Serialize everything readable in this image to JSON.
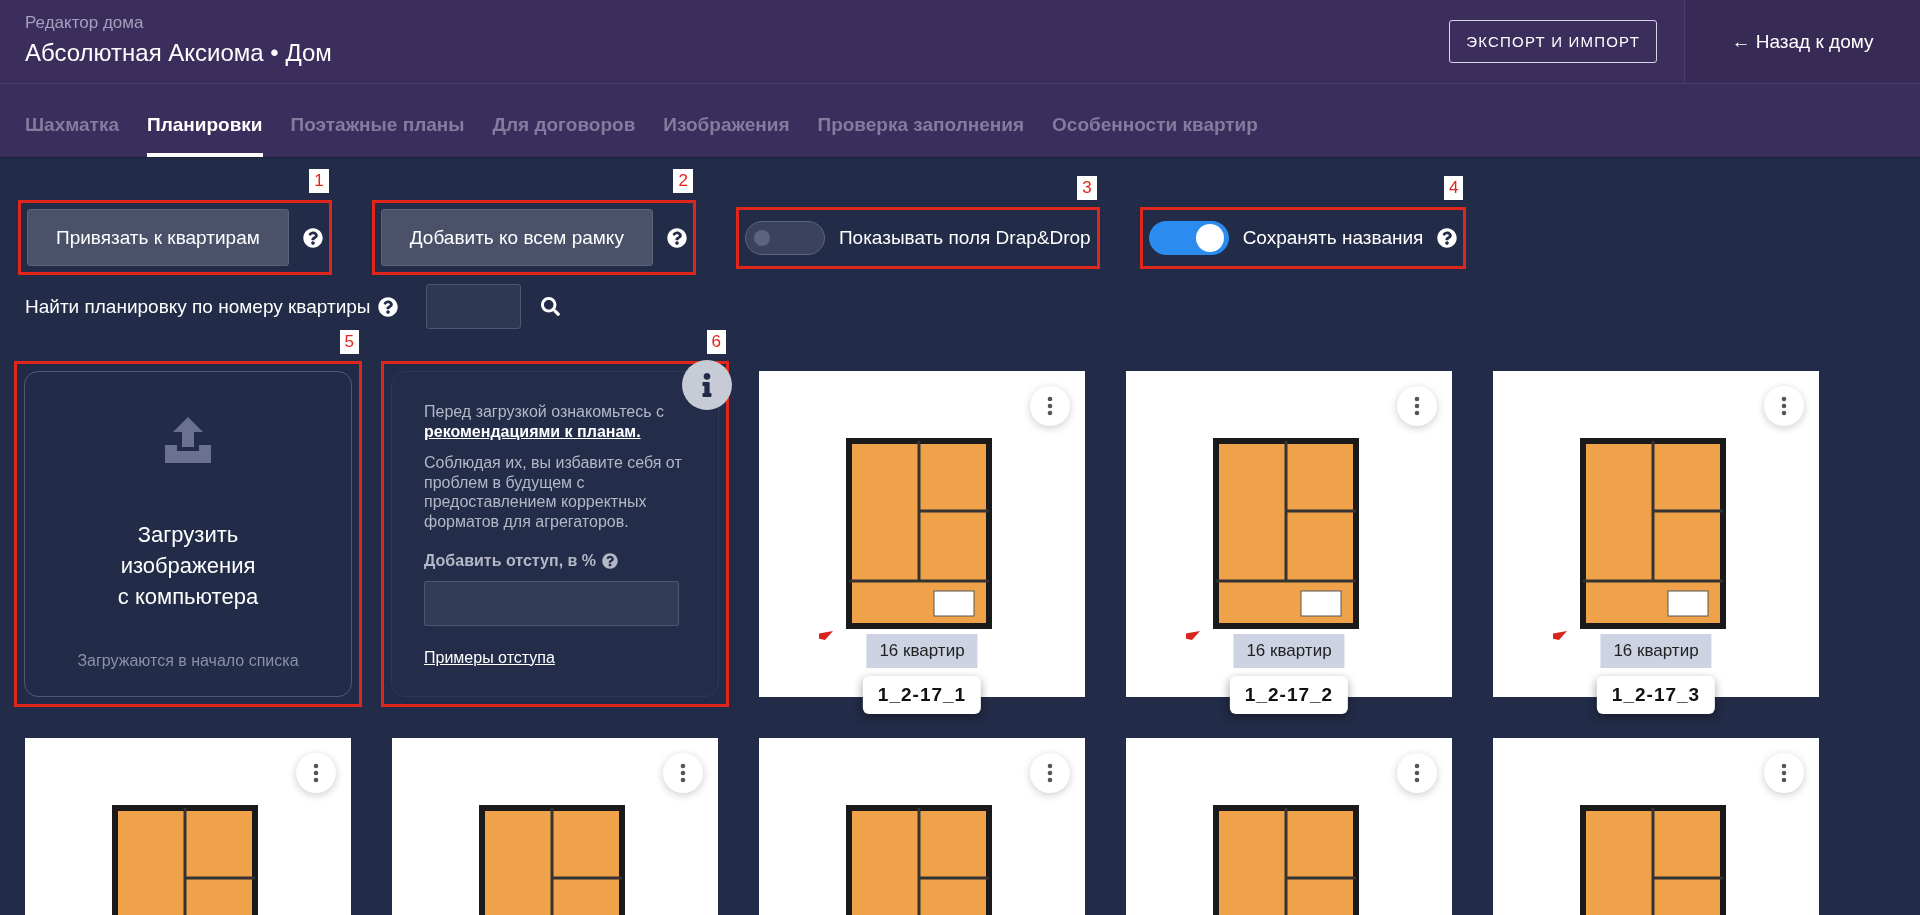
{
  "header": {
    "subtitle": "Редактор дома",
    "title": "Абсолютная Аксиома • Дом",
    "export_button": "ЭКСПОРТ И ИМПОРТ",
    "back_link": "← Назад к дому"
  },
  "tabs": [
    {
      "label": "Шахматка",
      "selected": false
    },
    {
      "label": "Планировки",
      "selected": true
    },
    {
      "label": "Поэтажные планы",
      "selected": false
    },
    {
      "label": "Для договоров",
      "selected": false
    },
    {
      "label": "Изображения",
      "selected": false
    },
    {
      "label": "Проверка заполнения",
      "selected": false
    },
    {
      "label": "Особенности квартир",
      "selected": false
    }
  ],
  "toolbar": [
    {
      "kind": "button",
      "label": "Привязать к квартирам",
      "help": true,
      "annotation": "1"
    },
    {
      "kind": "button",
      "label": "Добавить ко всем рамку",
      "help": true,
      "annotation": "2"
    },
    {
      "kind": "toggle",
      "label": "Показывать поля Drap&Drop",
      "on": false,
      "help": false,
      "annotation": "3"
    },
    {
      "kind": "toggle",
      "label": "Сохранять названия",
      "on": true,
      "help": true,
      "annotation": "4"
    }
  ],
  "search": {
    "label": "Найти планировку по номеру квартиры"
  },
  "cards": [
    {
      "kind": "upload",
      "title": "Загрузить\nизображения\nс компьютера",
      "note": "Загружаются в начало списка",
      "annotation": "5"
    },
    {
      "kind": "info",
      "intro": "Перед загрузкой ознакомьтесь с",
      "link": "рекомендациями к планам.",
      "body": "Соблюдая их, вы избавите себя от проблем в будущем с предоставлением корректных форматов для агрегаторов.",
      "field_label": "Добавить отступ, в %",
      "examples_link": "Примеры отступа",
      "annotation": "6"
    },
    {
      "kind": "plan",
      "count": "16 квартир",
      "name": "1_2-17_1"
    },
    {
      "kind": "plan",
      "count": "16 квартир",
      "name": "1_2-17_2"
    },
    {
      "kind": "plan",
      "count": "16 квартир",
      "name": "1_2-17_3"
    },
    {
      "kind": "plan"
    },
    {
      "kind": "plan"
    },
    {
      "kind": "plan"
    },
    {
      "kind": "plan"
    },
    {
      "kind": "plan"
    }
  ]
}
